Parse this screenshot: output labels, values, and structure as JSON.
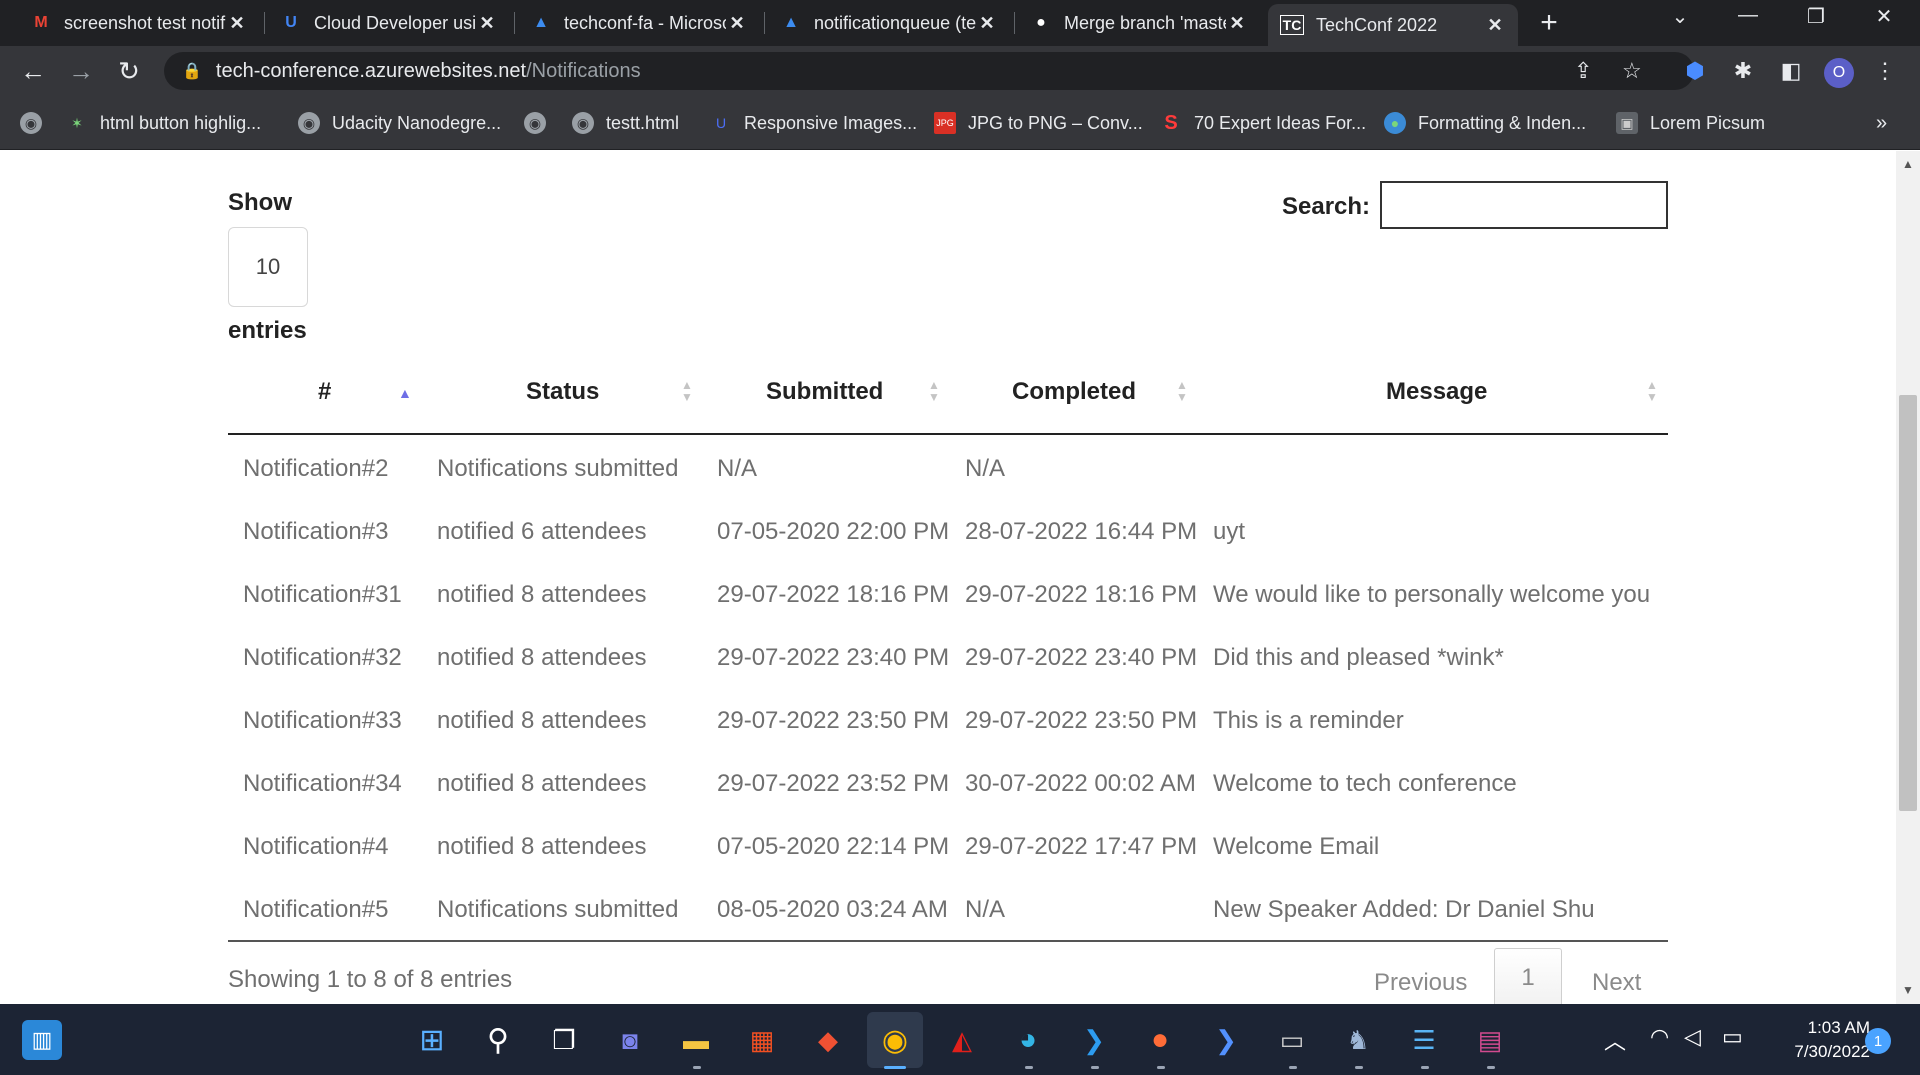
{
  "browser": {
    "tabs": [
      {
        "title": "screenshot test notification",
        "icon": "gmail-icon",
        "color": "#ea4335"
      },
      {
        "title": "Cloud Developer using Microsoft Azure",
        "icon": "udacity-icon",
        "color": "#4285f4"
      },
      {
        "title": "techconf-fa - Microsoft Azure",
        "icon": "azure-icon",
        "color": "#3c8cf0"
      },
      {
        "title": "notificationqueue (techconf)",
        "icon": "azure-icon",
        "color": "#3c8cf0"
      },
      {
        "title": "Merge branch 'master'",
        "icon": "github-icon",
        "color": "#ffffff"
      },
      {
        "title": "TechConf 2022",
        "icon": "techconf-icon",
        "color": "#ffffff"
      }
    ],
    "url_host": "tech-conference.azurewebsites.net",
    "url_path": "/Notifications",
    "profile_initial": "O",
    "bookmarks": [
      {
        "label": "html button highlig...",
        "icon": "sparkle-icon"
      },
      {
        "label": "Udacity Nanodegre...",
        "icon": "globe-icon"
      },
      {
        "label": "testt.html",
        "icon": "globe-icon"
      },
      {
        "label": "Responsive Images...",
        "icon": "udacity-icon"
      },
      {
        "label": "JPG to PNG – Conv...",
        "icon": "jpg-png-icon"
      },
      {
        "label": "70 Expert Ideas For...",
        "icon": "s-icon"
      },
      {
        "label": "Formatting & Inden...",
        "icon": "earth-icon"
      },
      {
        "label": "Lorem Picsum",
        "icon": "picsum-icon"
      }
    ],
    "more_bookmarks": "»"
  },
  "page": {
    "show_label": "Show",
    "page_length": "10",
    "entries_label": "entries",
    "search_label": "Search:",
    "search_value": "",
    "columns": [
      "#",
      "Status",
      "Submitted",
      "Completed",
      "Message"
    ],
    "rows": [
      {
        "id": "Notification#2",
        "status": "Notifications submitted",
        "submitted": "N/A",
        "completed": "N/A",
        "message": ""
      },
      {
        "id": "Notification#3",
        "status": "notified 6 attendees",
        "submitted": "07-05-2020 22:00 PM",
        "completed": "28-07-2022 16:44 PM",
        "message": "uyt"
      },
      {
        "id": "Notification#31",
        "status": "notified 8 attendees",
        "submitted": "29-07-2022 18:16 PM",
        "completed": "29-07-2022 18:16 PM",
        "message": "We would like to personally welcome you"
      },
      {
        "id": "Notification#32",
        "status": "notified 8 attendees",
        "submitted": "29-07-2022 23:40 PM",
        "completed": "29-07-2022 23:40 PM",
        "message": "Did this and pleased *wink*"
      },
      {
        "id": "Notification#33",
        "status": "notified 8 attendees",
        "submitted": "29-07-2022 23:50 PM",
        "completed": "29-07-2022 23:50 PM",
        "message": "This is a reminder"
      },
      {
        "id": "Notification#34",
        "status": "notified 8 attendees",
        "submitted": "29-07-2022 23:52 PM",
        "completed": "30-07-2022 00:02 AM",
        "message": "Welcome to tech conference"
      },
      {
        "id": "Notification#4",
        "status": "notified 8 attendees",
        "submitted": "07-05-2020 22:14 PM",
        "completed": "29-07-2022 17:47 PM",
        "message": "Welcome Email"
      },
      {
        "id": "Notification#5",
        "status": "Notifications submitted",
        "submitted": "08-05-2020 03:24 AM",
        "completed": "N/A",
        "message": "New Speaker Added: Dr Daniel Shu"
      }
    ],
    "info": "Showing 1 to 8 of 8 entries",
    "pagination": {
      "previous": "Previous",
      "current": "1",
      "next": "Next"
    }
  },
  "taskbar": {
    "apps": [
      "start-icon",
      "search-icon",
      "task-view-icon",
      "teams-chat-icon",
      "file-explorer-icon",
      "store-icon",
      "git-icon",
      "chrome-icon",
      "acrobat-icon",
      "edge-icon",
      "vscode-icon",
      "postman-icon",
      "powershell-icon",
      "terminal-icon",
      "postgres-icon",
      "notepad-icon",
      "winrar-icon"
    ],
    "time": "1:03 AM",
    "date": "7/30/2022",
    "notifications": "1"
  },
  "colors": {
    "chrome_dark": "#202124",
    "chrome_toolbar": "#35363a",
    "sort_active": "#6e6ee6",
    "taskbar": "#1c2434"
  }
}
